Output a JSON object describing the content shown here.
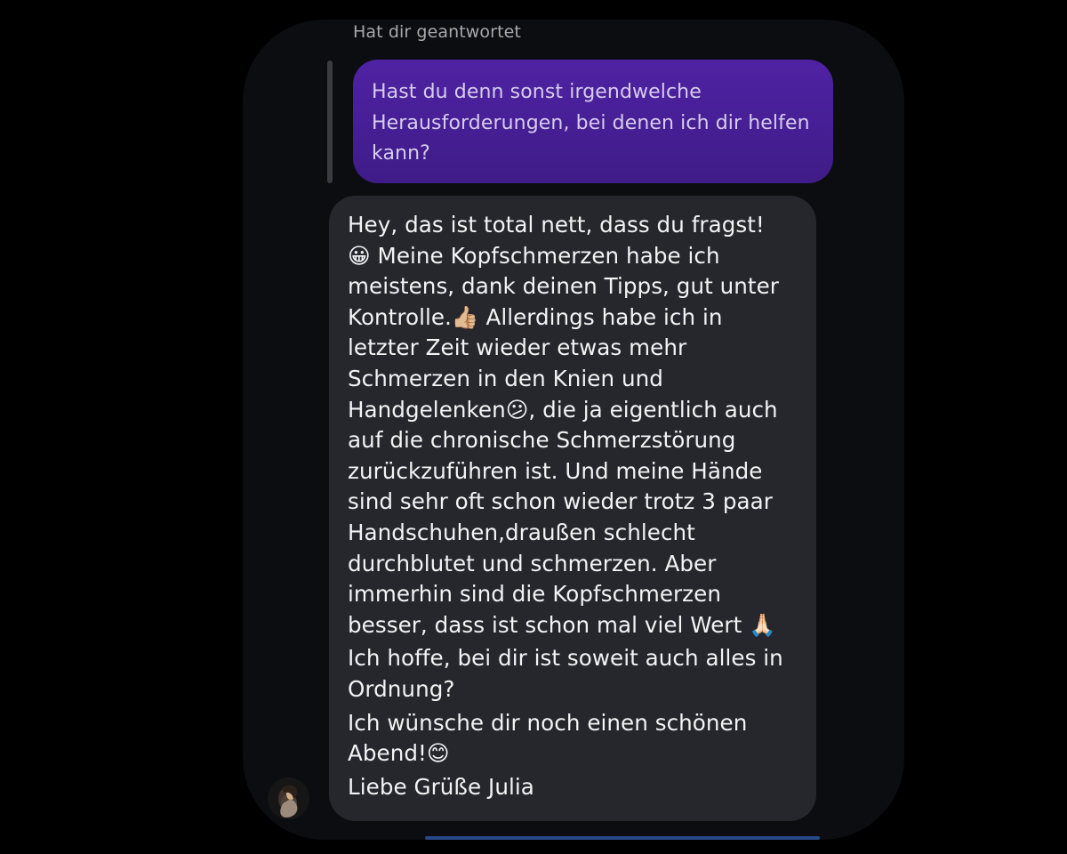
{
  "conversation": {
    "reply_header": "Hat dir geantwortet",
    "quoted_message": "Hast du denn sonst irgendwelche Herausforderungen, bei denen ich dir helfen kann?",
    "received_message": {
      "lines": [
        "Hey, das ist total nett, dass du fragst!\n😀 Meine Kopfschmerzen habe ich\nmeistens, dank deinen Tipps, gut unter\nKontrolle.👍🏼 Allerdings habe ich in\nletzter Zeit wieder etwas mehr\nSchmerzen in den Knien und\nHandgelenken😕, die ja eigentlich auch\nauf die chronische Schmerzstörung\nzurückzuführen ist. Und meine Hände\nsind sehr oft schon wieder trotz 3 paar\nHandschuhen,draußen schlecht\ndurchblutet und schmerzen. Aber\nimmerhin sind die Kopfschmerzen\nbesser, dass ist schon mal viel Wert 🙏🏻",
        "Ich hoffe, bei dir ist soweit auch alles in\nOrdnung?",
        "Ich wünsche dir noch einen schönen\nAbend!😊",
        "Liebe Grüße Julia"
      ]
    }
  },
  "colors": {
    "background": "#000000",
    "screen": "#0c0d10",
    "sent_bubble": "#4f22a3",
    "received_bubble": "#25272d"
  },
  "icons": {
    "avatar": "profile-photo-icon"
  }
}
